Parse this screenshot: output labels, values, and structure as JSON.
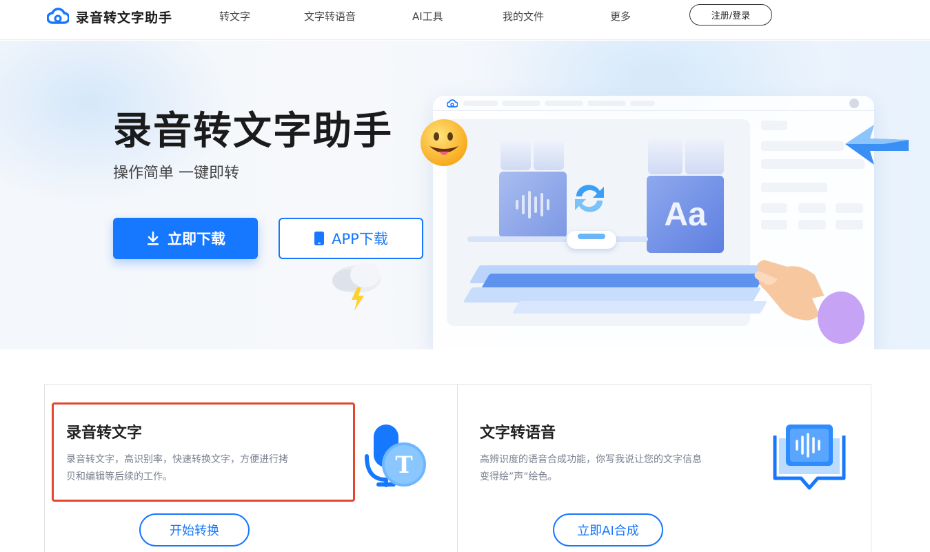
{
  "header": {
    "logo_text": "录音转文字助手",
    "nav": [
      "转文字",
      "文字转语音",
      "AI工具",
      "我的文件",
      "更多"
    ],
    "login_label": "注册/登录"
  },
  "hero": {
    "title": "录音转文字助手",
    "subtitle": "操作简单 一键即转",
    "download_label": "立即下载",
    "app_label": "APP下载",
    "illustration_glyph": "Aa"
  },
  "cards": [
    {
      "title": "录音转文字",
      "desc_line1": "录音转文字，高识别率，快速转换文字，方便进行拷",
      "desc_line2": "贝和编辑等后续的工作。",
      "button": "开始转换",
      "icon_letter": "T"
    },
    {
      "title": "文字转语音",
      "desc_line1": "高辨识度的语音合成功能，你写我说让您的文字信息",
      "desc_line2": "变得绘”声”绘色。",
      "button": "立即AI合成"
    }
  ],
  "colors": {
    "accent": "#1677ff",
    "highlight": "#e0472f"
  }
}
